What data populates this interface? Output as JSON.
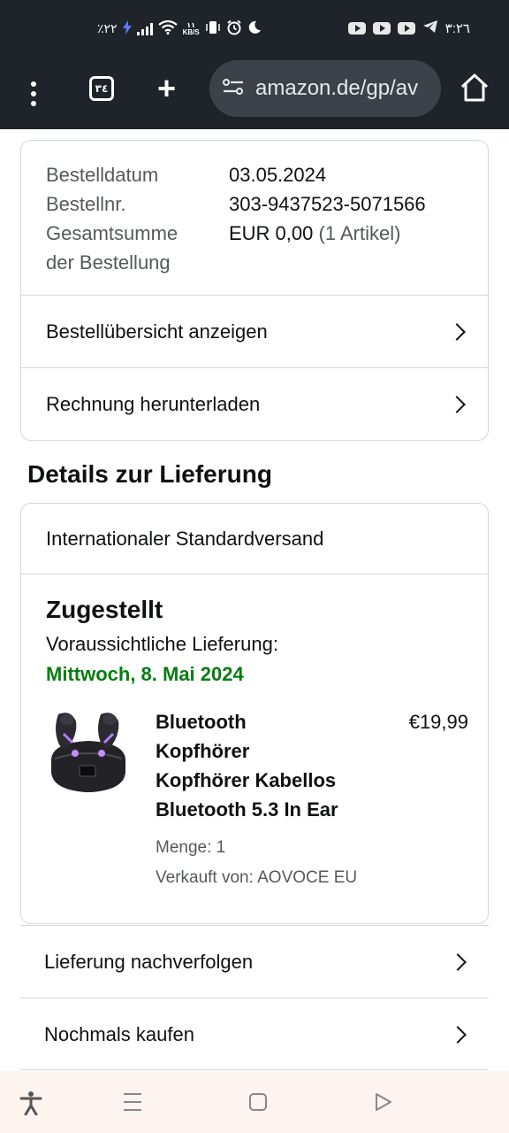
{
  "status_bar": {
    "battery": "٪٢٢",
    "speed_value": "١١",
    "speed_unit": "KB/S",
    "time": "٣:٢٦"
  },
  "browser": {
    "tab_count": "٣٤",
    "url": "amazon.de/gp/av"
  },
  "order_info": {
    "date_label": "Bestelldatum",
    "date_value": "03.05.2024",
    "number_label": "Bestellnr.",
    "number_value": "303-9437523-5071566",
    "total_label_line1": "Gesamtsumme",
    "total_label_line2": "der Bestellung",
    "total_value": "EUR 0,00",
    "total_items": "(1 Artikel)"
  },
  "order_links": [
    {
      "label": "Bestellübersicht anzeigen"
    },
    {
      "label": "Rechnung herunterladen"
    }
  ],
  "delivery": {
    "section_title": "Details zur Lieferung",
    "shipping_method": "Internationaler Standardversand",
    "status": "Zugestellt",
    "expected_label": "Voraussichtliche Lieferung:",
    "expected_date": "Mittwoch, 8. Mai 2024"
  },
  "product": {
    "title_lines": [
      "Bluetooth",
      "Kopfhörer",
      "Kopfhörer Kabellos",
      "Bluetooth 5.3 In Ear"
    ],
    "price": "€19,99",
    "quantity": "Menge: 1",
    "seller": "Verkauft von: AOVOCE EU"
  },
  "actions": [
    {
      "label": "Lieferung nachverfolgen"
    },
    {
      "label": "Nochmals kaufen"
    }
  ],
  "colors": {
    "delivery_date": "#067d10",
    "status_bar_bg": "#1e242a",
    "nav_bar_bg": "#fdf3ef"
  }
}
